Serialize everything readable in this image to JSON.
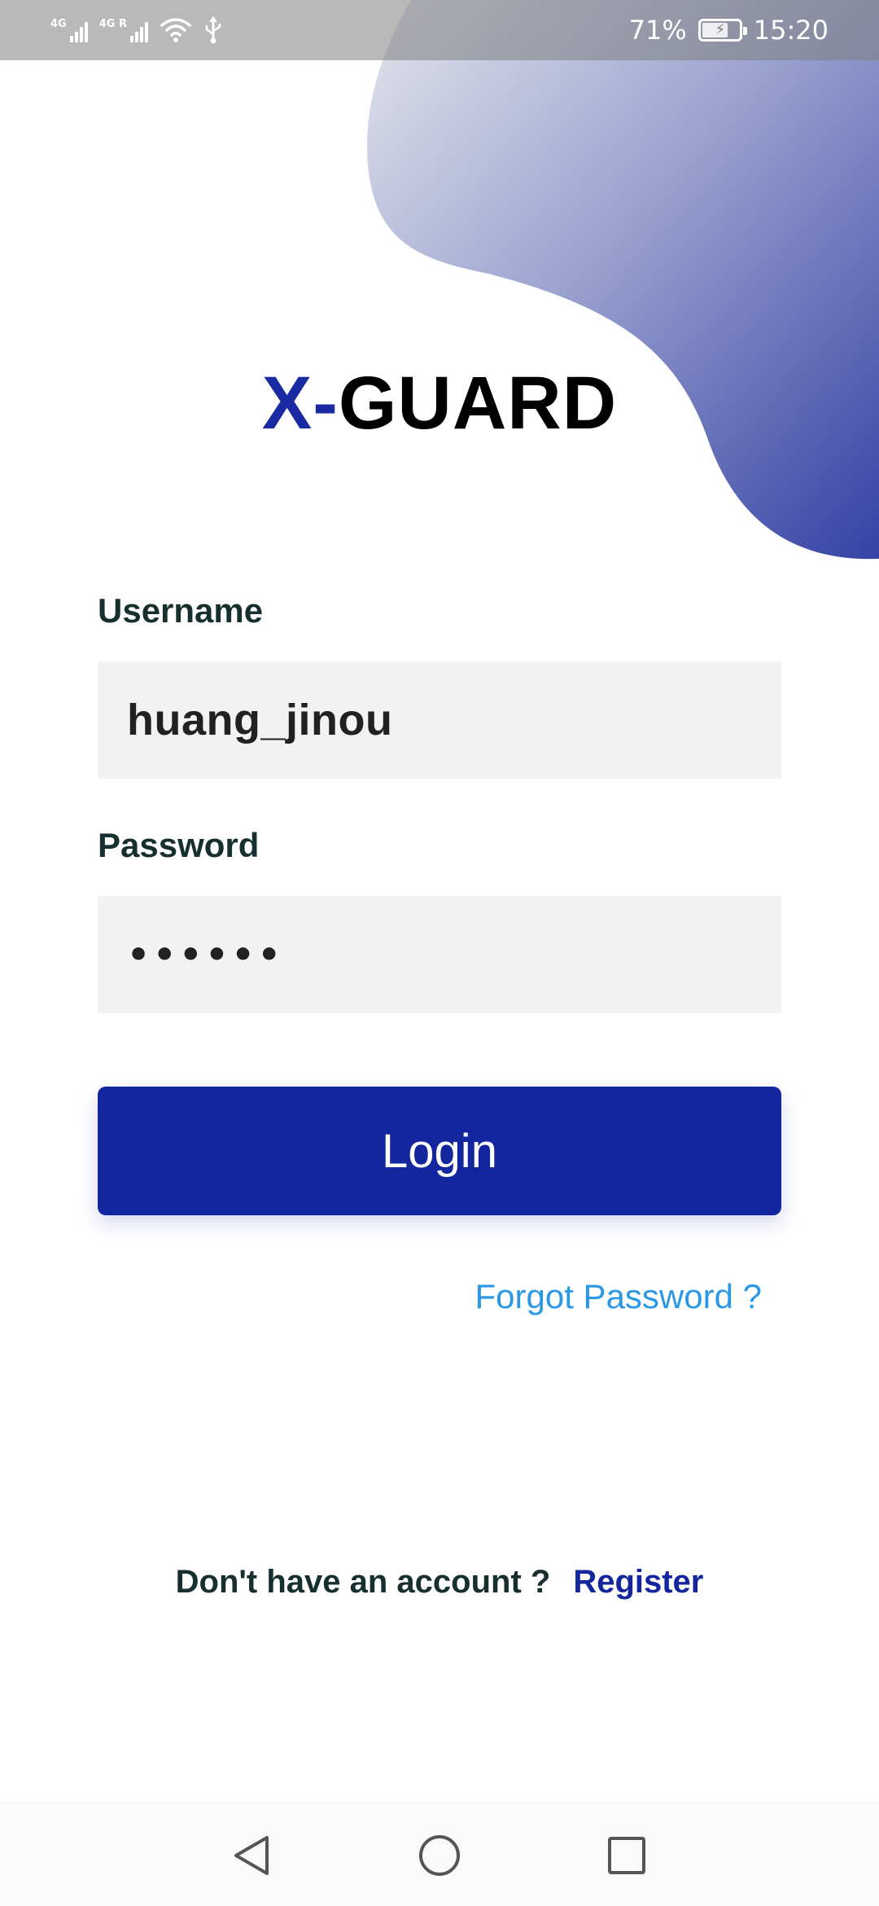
{
  "status_bar": {
    "signal_1_label": "4G",
    "signal_2_label": "4G R",
    "battery_percent_text": "71%",
    "battery_level": 0.71,
    "time": "15:20",
    "icons": [
      "signal-icon",
      "signal-roaming-icon",
      "wifi-icon",
      "usb-icon",
      "battery-charging-icon"
    ]
  },
  "logo": {
    "part_1": "X-",
    "part_2": "GUARD"
  },
  "form": {
    "username_label": "Username",
    "username_value": "huang_jinou",
    "password_label": "Password",
    "password_value": "••••••",
    "login_label": "Login",
    "forgot_password": "Forgot Password ?"
  },
  "footer": {
    "no_account_text": "Don't have an account ?",
    "register_label": "Register"
  },
  "nav_bar": {
    "icons": [
      "back-icon",
      "home-icon",
      "recents-icon"
    ]
  },
  "colors": {
    "brand_blue": "#14269e",
    "link_blue": "#2b98e6",
    "label_dark": "#17302f",
    "input_bg": "#f2f2f2",
    "blob_start": "#e2e3ea",
    "blob_end": "#3a48a8"
  }
}
